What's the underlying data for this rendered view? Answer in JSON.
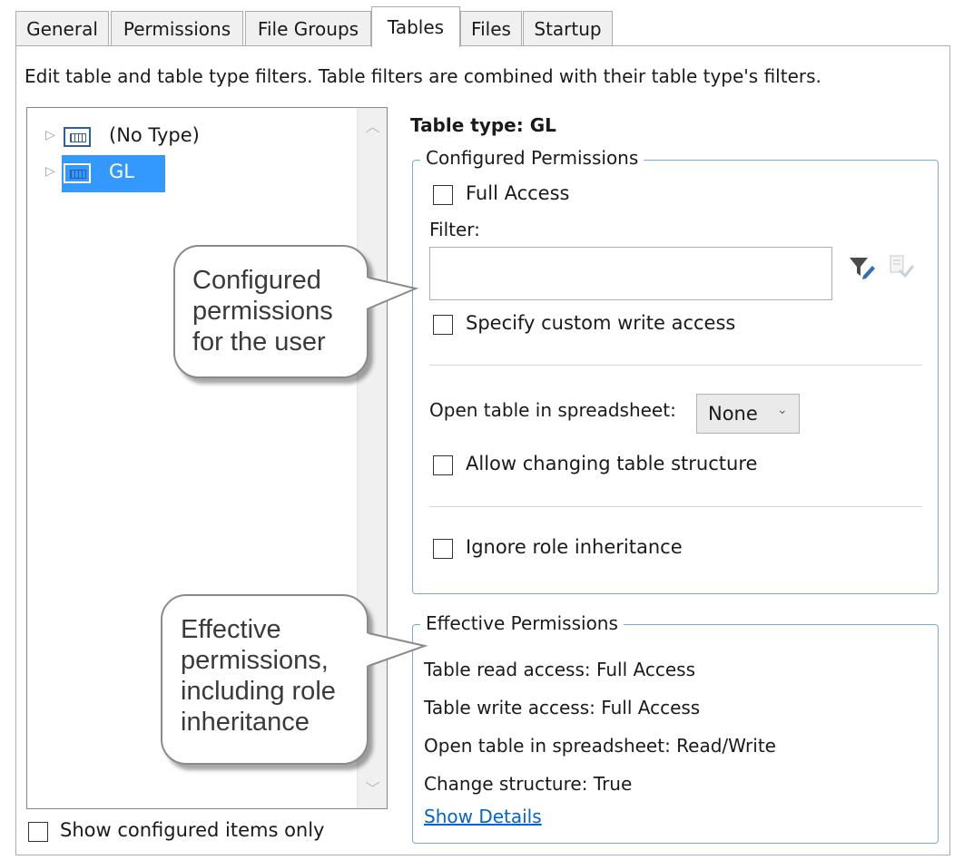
{
  "tabs": [
    "General",
    "Permissions",
    "File Groups",
    "Tables",
    "Files",
    "Startup"
  ],
  "active_tab": "Tables",
  "description": "Edit table and table type filters. Table filters are combined with their table type's filters.",
  "tree": {
    "items": [
      {
        "label": "(No Type)",
        "selected": false
      },
      {
        "label": "GL",
        "selected": true
      }
    ],
    "show_configured_only_label": "Show configured items only"
  },
  "table_type_label": "Table type: GL",
  "configured": {
    "legend": "Configured Permissions",
    "full_access_label": "Full Access",
    "filter_label": "Filter:",
    "filter_value": "",
    "custom_write_label": "Specify custom write access",
    "open_spreadsheet_label": "Open table in spreadsheet:",
    "open_spreadsheet_value": "None",
    "allow_structure_label": "Allow changing table structure",
    "ignore_inheritance_label": "Ignore role inheritance"
  },
  "effective": {
    "legend": "Effective Permissions",
    "read_access": "Table read access: Full Access",
    "write_access": "Table write access: Full Access",
    "open_spreadsheet": "Open table in spreadsheet: Read/Write",
    "change_structure": "Change structure: True",
    "show_details_link": "Show Details"
  },
  "callouts": {
    "configured": [
      "Configured",
      "permissions",
      "for the user"
    ],
    "effective": [
      "Effective",
      "permissions,",
      "including role",
      "inheritance"
    ]
  },
  "icons": {
    "filter_edit": "filter-edit-icon",
    "filter_apply": "filter-apply-icon",
    "expander": "expander-triangle-icon",
    "table": "table-icon"
  },
  "colors": {
    "selection": "#3399ff",
    "group_border": "#7ea6d8",
    "link": "#0066cc"
  }
}
